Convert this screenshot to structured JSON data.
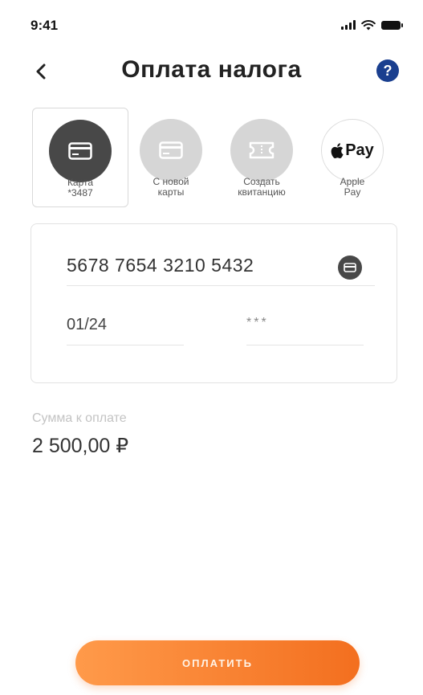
{
  "status_bar": {
    "time": "9:41"
  },
  "header": {
    "title": "Оплата налога",
    "help": "?"
  },
  "payment_methods": [
    {
      "line1": "Карта",
      "line2": "*3487",
      "icon": "card-icon",
      "selected": true
    },
    {
      "line1": "С новой",
      "line2": "карты",
      "icon": "card-icon",
      "selected": false
    },
    {
      "line1": "Создать",
      "line2": "квитанцию",
      "icon": "ticket-icon",
      "selected": false
    },
    {
      "line1": "Apple",
      "line2": "Pay",
      "icon": "apple-pay-icon",
      "selected": false,
      "badge": "Pay"
    }
  ],
  "card_form": {
    "number": "5678 7654 3210 5432",
    "expiry": "01/24",
    "cvv": "***"
  },
  "amount": {
    "label": "Сумма к оплате",
    "value": "2 500,00 ₽"
  },
  "pay_button": {
    "label": "ОПЛАТИТЬ"
  },
  "colors": {
    "accent": "#f36f1f",
    "help": "#1a3f8f",
    "dark_icon": "#484848"
  }
}
